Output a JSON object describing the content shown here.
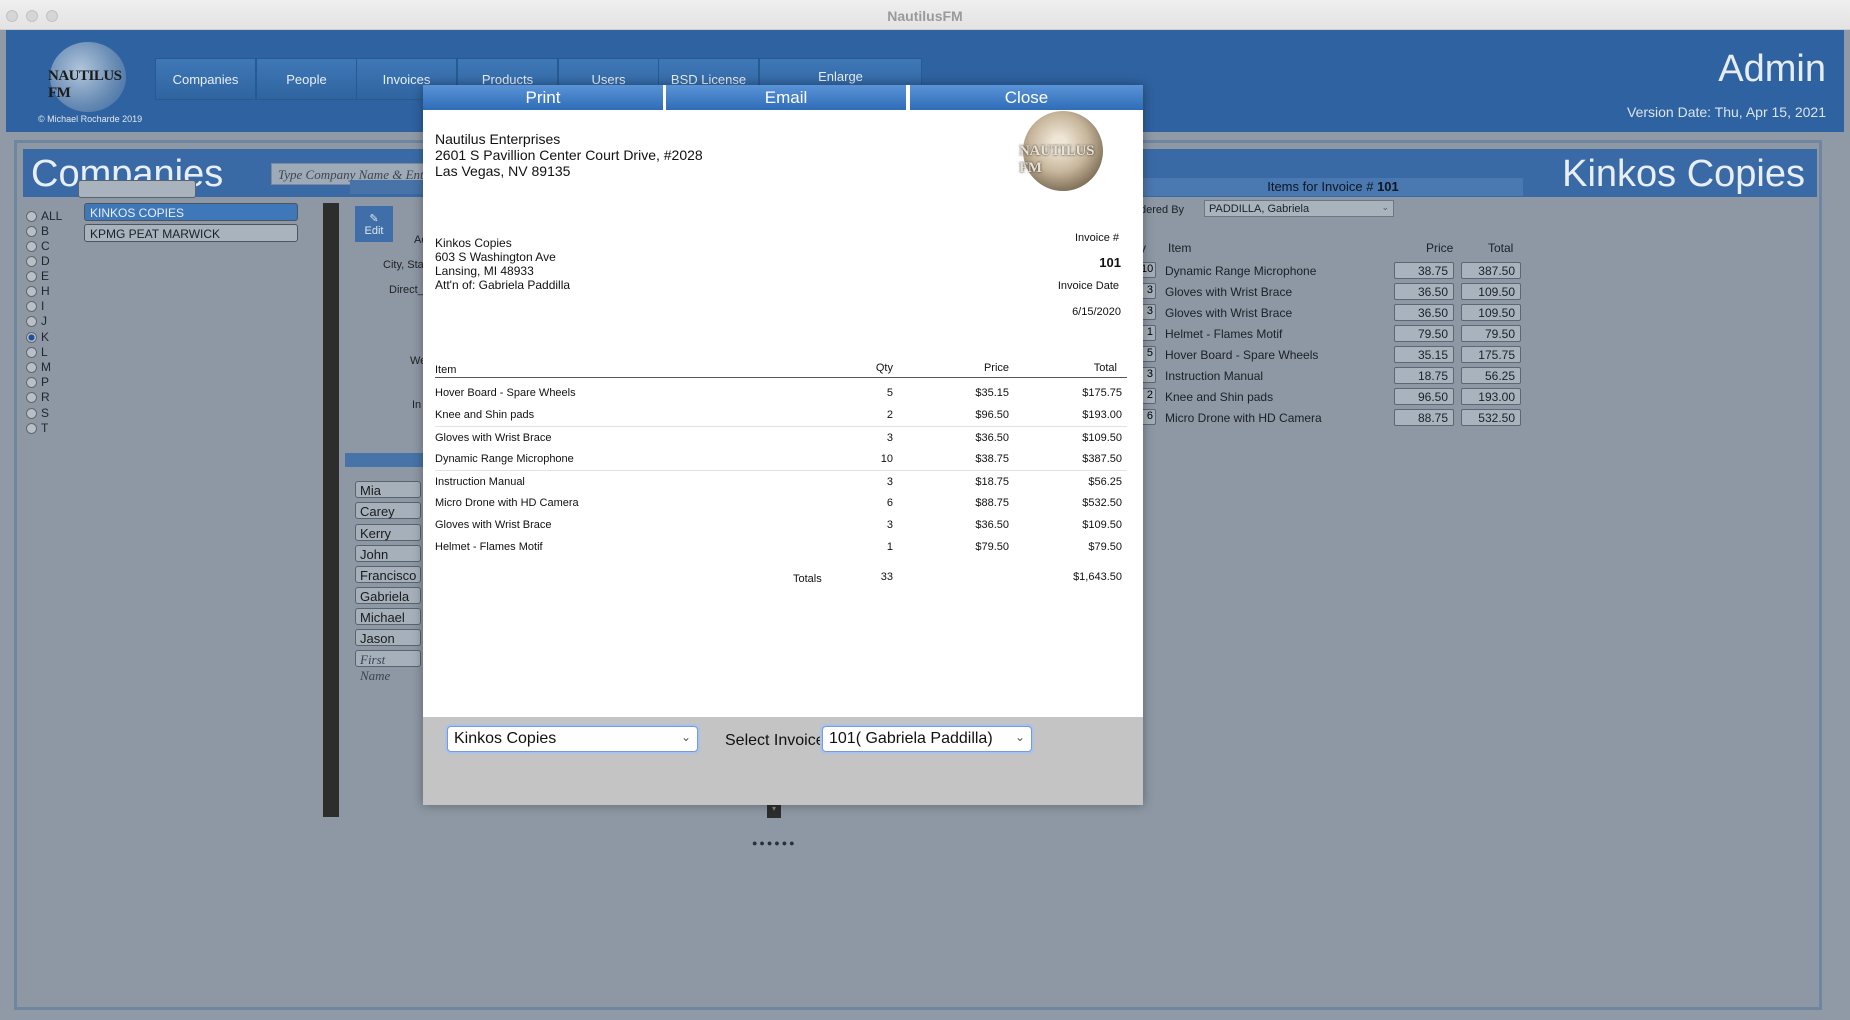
{
  "window": {
    "title": "NautilusFM"
  },
  "header": {
    "logo_text": "NAUTILUS FM",
    "copyright": "© Michael Rocharde 2019",
    "nav": [
      "Companies",
      "People",
      "Invoices",
      "Products",
      "Users",
      "BSD License",
      "Enlarge"
    ],
    "user_label": "Admin",
    "version": "Version Date: Thu, Apr 15, 2021"
  },
  "companies_panel": {
    "title": "Companies",
    "search_placeholder": "Type Company Name & Enter",
    "selected_company": "Kinkos Copies",
    "alpha_filters": [
      "ALL",
      "B",
      "C",
      "D",
      "E",
      "H",
      "I",
      "J",
      "K",
      "L",
      "M",
      "P",
      "R",
      "S",
      "T"
    ],
    "alpha_selected": "K",
    "company_list": [
      "KINKOS COPIES",
      "KPMG PEAT MARWICK"
    ],
    "edit_label": "Edit",
    "field_labels": [
      "Ac",
      "City, Stat",
      "Direct_I",
      "We",
      "In"
    ],
    "people": [
      "Mia",
      "Carey",
      "Kerry",
      "John",
      "Francisco",
      "Gabriela",
      "Michael",
      "Jason"
    ],
    "people_placeholder": "First Name"
  },
  "items_panel": {
    "title_prefix": "Items for Invoice #",
    "invoice_number": "101",
    "ordered_by_label": "dered By",
    "ordered_by_value": "PADDILLA, Gabriela",
    "col_qty": "y",
    "col_item": "Item",
    "col_price": "Price",
    "col_total": "Total",
    "rows": [
      {
        "qty": "10",
        "item": "Dynamic Range Microphone",
        "price": "38.75",
        "total": "387.50"
      },
      {
        "qty": "3",
        "item": "Gloves with Wrist Brace",
        "price": "36.50",
        "total": "109.50"
      },
      {
        "qty": "3",
        "item": "Gloves with Wrist Brace",
        "price": "36.50",
        "total": "109.50"
      },
      {
        "qty": "1",
        "item": "Helmet - Flames Motif",
        "price": "79.50",
        "total": "79.50"
      },
      {
        "qty": "5",
        "item": "Hover Board - Spare Wheels",
        "price": "35.15",
        "total": "175.75"
      },
      {
        "qty": "3",
        "item": "Instruction Manual",
        "price": "18.75",
        "total": "56.25"
      },
      {
        "qty": "2",
        "item": "Knee and Shin pads",
        "price": "96.50",
        "total": "193.00"
      },
      {
        "qty": "6",
        "item": "Micro Drone with HD Camera",
        "price": "88.75",
        "total": "532.50"
      }
    ]
  },
  "modal": {
    "buttons": {
      "print": "Print",
      "email": "Email",
      "close": "Close"
    },
    "logo_text": "NAUTILUS FM",
    "from": [
      "Nautilus Enterprises",
      "2601 S Pavillion Center Court Drive, #2028",
      "Las Vegas, NV 89135"
    ],
    "bill_to": [
      "Kinkos Copies",
      "603 S Washington Ave",
      "Lansing, MI 48933",
      "Att'n of: Gabriela Paddilla"
    ],
    "invoice_label": "Invoice #",
    "invoice_number": "101",
    "date_label": "Invoice Date",
    "date": "6/15/2020",
    "columns": {
      "item": "Item",
      "qty": "Qty",
      "price": "Price",
      "total": "Total"
    },
    "rows": [
      {
        "item": "Hover Board - Spare Wheels",
        "qty": "5",
        "price": "$35.15",
        "total": "$175.75"
      },
      {
        "item": "Knee and Shin pads",
        "qty": "2",
        "price": "$96.50",
        "total": "$193.00"
      },
      {
        "item": "Gloves with Wrist Brace",
        "qty": "3",
        "price": "$36.50",
        "total": "$109.50"
      },
      {
        "item": "Dynamic Range Microphone",
        "qty": "10",
        "price": "$38.75",
        "total": "$387.50"
      },
      {
        "item": "Instruction Manual",
        "qty": "3",
        "price": "$18.75",
        "total": "$56.25"
      },
      {
        "item": "Micro Drone with HD Camera",
        "qty": "6",
        "price": "$88.75",
        "total": "$532.50"
      },
      {
        "item": "Gloves with Wrist Brace",
        "qty": "3",
        "price": "$36.50",
        "total": "$109.50"
      },
      {
        "item": "Helmet - Flames Motif",
        "qty": "1",
        "price": "$79.50",
        "total": "$79.50"
      }
    ],
    "totals_label": "Totals",
    "totals_qty": "33",
    "totals_amount": "$1,643.50",
    "company_select": "Kinkos Copies",
    "select_invoice_label": "Select Invoice",
    "invoice_select": "101( Gabriela Paddilla)"
  },
  "colors": {
    "accent": "#2f62a0",
    "modal_button": "#3a78c4",
    "selected": "#3f78b8"
  }
}
